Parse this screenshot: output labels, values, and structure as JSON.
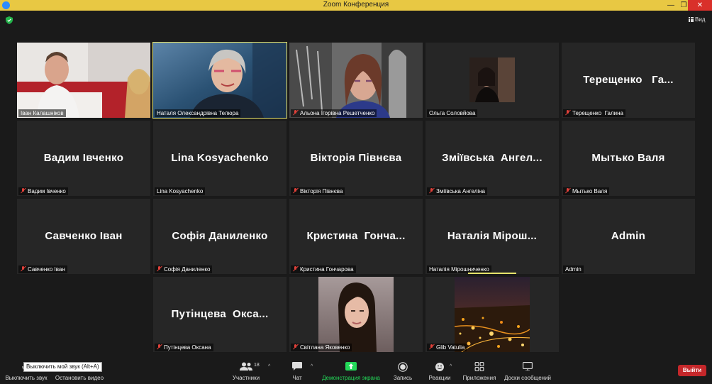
{
  "window": {
    "title": "Zoom Конференция",
    "minimize": "—",
    "maximize": "❐",
    "close": "✕"
  },
  "view_button": "Вид",
  "participants": [
    {
      "name": "Іван Калашніков",
      "big": "",
      "muted": false,
      "video": true
    },
    {
      "name": "Наталя Олександрівна Телюра",
      "big": "",
      "muted": false,
      "video": true,
      "active": true
    },
    {
      "name": "Альона Ігорівна Решетченко",
      "big": "",
      "muted": true,
      "video": true
    },
    {
      "name": "Ольга Соловйова",
      "big": "",
      "muted": false,
      "video": true
    },
    {
      "name": "Терещенко  Галина",
      "big": "Терещенко   Га...",
      "muted": true,
      "video": false
    },
    {
      "name": "Вадим Івченко",
      "big": "Вадим Івченко",
      "muted": true,
      "video": false
    },
    {
      "name": "Lina Kosyachenko",
      "big": "Lina Kosyachenko",
      "muted": false,
      "video": false
    },
    {
      "name": "Вікторія Півнєва",
      "big": "Вікторія Півнєва",
      "muted": true,
      "video": false
    },
    {
      "name": "Зміївська Ангеліна",
      "big": "Зміївська  Ангел...",
      "muted": true,
      "video": false
    },
    {
      "name": "Мытько Валя",
      "big": "Мытько Валя",
      "muted": true,
      "video": false
    },
    {
      "name": "Савченко Іван",
      "big": "Савченко Іван",
      "muted": true,
      "video": false
    },
    {
      "name": "Софія Даниленко",
      "big": "Софія Даниленко",
      "muted": true,
      "video": false
    },
    {
      "name": "Кристина Гончарова",
      "big": "Кристина  Гонча...",
      "muted": true,
      "video": false
    },
    {
      "name": "Наталія Мірошниченко",
      "big": "Наталія Мірош...",
      "muted": false,
      "video": false
    },
    {
      "name": "Admin",
      "big": "Admin",
      "muted": false,
      "video": false
    },
    {
      "name": "Путінцева Оксана",
      "big": "Путінцева  Окса...",
      "muted": true,
      "video": false
    },
    {
      "name": "Світлана Яковенко",
      "big": "",
      "muted": true,
      "video": true
    },
    {
      "name": "Glib Vatulia",
      "big": "",
      "muted": true,
      "video": true
    }
  ],
  "toolbar": {
    "mute_label": "Выключить звук",
    "video_label": "Остановить видео",
    "participants_label": "Участники",
    "participants_count": "18",
    "chat_label": "Чат",
    "share_label": "Демонстрация экрана",
    "record_label": "Запись",
    "reactions_label": "Реакции",
    "apps_label": "Приложения",
    "whiteboard_label": "Доски сообщений",
    "exit_label": "Выйти",
    "tooltip": "Выключить мой звук (Alt+A)"
  },
  "colors": {
    "titlebar": "#e8c843",
    "share_green": "#23d959",
    "exit_red": "#c4272a",
    "mute_red": "#e0413a",
    "active_speaker": "#e6e36b"
  }
}
